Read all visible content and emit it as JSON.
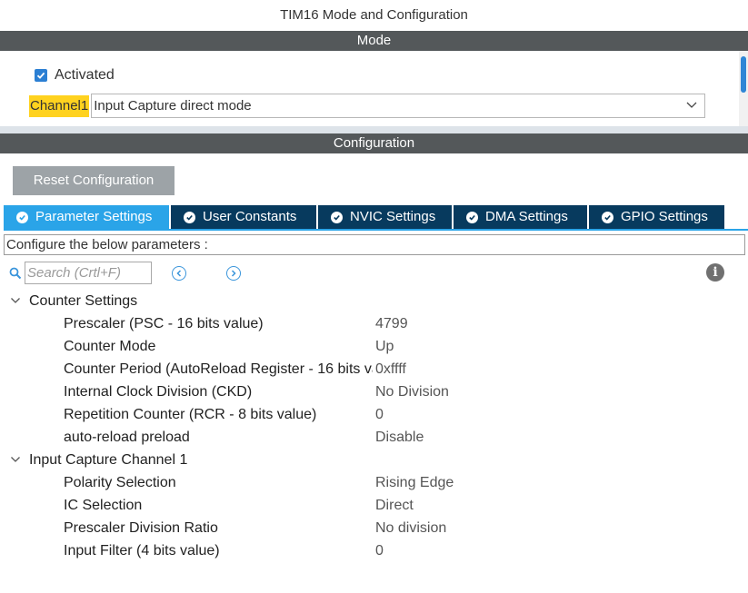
{
  "window": {
    "title": "TIM16 Mode and Configuration"
  },
  "mode": {
    "header": "Mode",
    "activated": {
      "label": "Activated",
      "checked": true
    },
    "channel": {
      "label": "Channel1",
      "value": "Input Capture direct mode"
    }
  },
  "configuration": {
    "header": "Configuration",
    "reset_label": "Reset Configuration",
    "tabs": [
      {
        "label": "Parameter Settings",
        "active": true
      },
      {
        "label": "User Constants",
        "active": false
      },
      {
        "label": "NVIC Settings",
        "active": false
      },
      {
        "label": "DMA Settings",
        "active": false
      },
      {
        "label": "GPIO Settings",
        "active": false
      }
    ],
    "configure_text": "Configure the below parameters :",
    "search": {
      "placeholder": "Search (Crtl+F)"
    },
    "groups": [
      {
        "label": "Counter Settings",
        "params": [
          {
            "name": "Prescaler (PSC - 16 bits value)",
            "value": "4799"
          },
          {
            "name": "Counter Mode",
            "value": "Up"
          },
          {
            "name": "Counter Period (AutoReload Register - 16 bits va",
            "value": "0xffff"
          },
          {
            "name": "Internal Clock Division (CKD)",
            "value": "No Division"
          },
          {
            "name": "Repetition Counter (RCR - 8 bits value)",
            "value": "0"
          },
          {
            "name": "auto-reload preload",
            "value": "Disable"
          }
        ]
      },
      {
        "label": "Input Capture Channel 1",
        "params": [
          {
            "name": "Polarity Selection",
            "value": "Rising Edge"
          },
          {
            "name": "IC Selection",
            "value": "Direct"
          },
          {
            "name": "Prescaler Division Ratio",
            "value": "No division"
          },
          {
            "name": "Input Filter (4 bits value)",
            "value": "0"
          }
        ]
      }
    ]
  },
  "colors": {
    "section_bar": "#54585a",
    "tab_active": "#2aa4e8",
    "tab_inactive": "#073a5e",
    "channel_highlight": "#ffd21f",
    "accent": "#2b7fd3"
  }
}
